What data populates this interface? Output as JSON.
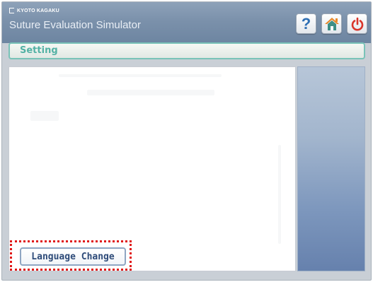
{
  "header": {
    "brand": "KYOTO KAGAKU",
    "app_title": "Suture Evaluation Simulator",
    "buttons": [
      {
        "icon": "help-icon",
        "glyph": "?"
      },
      {
        "icon": "home-icon"
      },
      {
        "icon": "power-icon"
      }
    ]
  },
  "setting_bar": {
    "label": "Setting"
  },
  "content": {
    "language_button_label": "Language Change"
  },
  "colors": {
    "header_blue": "#7b91ab",
    "setting_teal": "#53b1a4",
    "highlight_red": "#e01818",
    "home_orange": "#e8882a",
    "power_red": "#d9352b",
    "help_blue": "#2f6fb4"
  }
}
